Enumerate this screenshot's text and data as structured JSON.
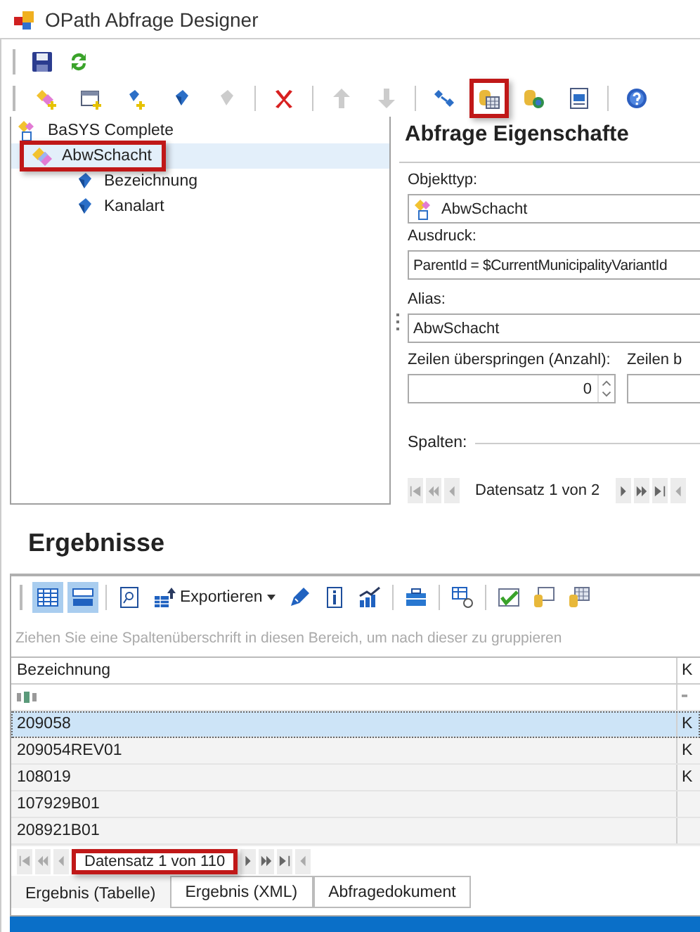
{
  "window": {
    "title": "OPath Abfrage Designer"
  },
  "toolbar_1": [
    {
      "kind": "save",
      "disabled": false
    },
    {
      "kind": "refresh",
      "disabled": false
    }
  ],
  "toolbar_2": [
    {
      "kind": "add-object",
      "disabled": false,
      "highlighted": false
    },
    {
      "kind": "add-table",
      "disabled": false,
      "highlighted": false
    },
    {
      "kind": "add-field",
      "disabled": false,
      "highlighted": false
    },
    {
      "kind": "field",
      "disabled": false,
      "highlighted": false
    },
    {
      "kind": "remove-field",
      "disabled": true,
      "highlighted": false
    },
    {
      "kind": "separator"
    },
    {
      "kind": "delete",
      "disabled": false,
      "highlighted": false
    },
    {
      "kind": "separator"
    },
    {
      "kind": "up",
      "disabled": true,
      "highlighted": false
    },
    {
      "kind": "down",
      "disabled": true,
      "highlighted": false
    },
    {
      "kind": "separator"
    },
    {
      "kind": "link",
      "disabled": false,
      "highlighted": false
    },
    {
      "kind": "db-table",
      "disabled": false,
      "highlighted": true
    },
    {
      "kind": "db-globe",
      "disabled": false,
      "highlighted": false
    },
    {
      "kind": "xml-doc",
      "disabled": false,
      "highlighted": false
    },
    {
      "kind": "separator"
    },
    {
      "kind": "help",
      "disabled": false,
      "highlighted": false
    }
  ],
  "tree": [
    {
      "kind": "root",
      "label": "BaSYS Complete",
      "selected": false,
      "highlighted": false,
      "children": [
        {
          "kind": "object",
          "label": "AbwSchacht",
          "selected": true,
          "highlighted": true,
          "children": [
            {
              "kind": "field",
              "label": "Bezeichnung",
              "selected": false,
              "highlighted": false
            },
            {
              "kind": "field",
              "label": "Kanalart",
              "selected": false,
              "highlighted": false
            }
          ]
        }
      ]
    }
  ],
  "properties": {
    "title": "Abfrage Eigenschafte",
    "objekttyp": {
      "label": "Objekttyp:",
      "value": "AbwSchacht"
    },
    "ausdruck": {
      "label": "Ausdruck:",
      "value": "ParentId = $CurrentMunicipalityVariantId"
    },
    "alias": {
      "label": "Alias:",
      "value": "AbwSchacht"
    },
    "skip_rows": {
      "label": "Zeilen überspringen (Anzahl):",
      "value": "0"
    },
    "field_2": {
      "label": "Zeilen b"
    },
    "spalten": {
      "label": "Spalten:"
    },
    "navigator": {
      "record": "Datensatz 1 von 2",
      "highlighted": false
    }
  },
  "results": {
    "title": "Ergebnisse",
    "toolbar": [
      {
        "kind": "grid-view",
        "selected": true
      },
      {
        "kind": "card-view",
        "selected": true
      },
      {
        "kind": "separator"
      },
      {
        "kind": "find",
        "selected": false
      },
      {
        "kind": "export",
        "label": "Exportieren",
        "selected": false
      },
      {
        "kind": "pen",
        "selected": false
      },
      {
        "kind": "info",
        "selected": false
      },
      {
        "kind": "chart",
        "selected": false
      },
      {
        "kind": "separator"
      },
      {
        "kind": "toolbox",
        "selected": false
      },
      {
        "kind": "separator"
      },
      {
        "kind": "column-refresh",
        "selected": false
      },
      {
        "kind": "separator"
      },
      {
        "kind": "checked-box",
        "selected": false
      },
      {
        "kind": "db-window",
        "selected": false
      },
      {
        "kind": "db-grid",
        "selected": false
      }
    ],
    "group_hint": "Ziehen Sie eine Spaltenüberschrift in diesen Bereich, um nach dieser zu gruppieren",
    "table": {
      "columns": [
        "Bezeichnung",
        "K"
      ],
      "rows": [
        {
          "cells": [
            "209058",
            "K"
          ],
          "selected": true
        },
        {
          "cells": [
            "209054REV01",
            "K"
          ],
          "selected": false
        },
        {
          "cells": [
            "108019",
            "K"
          ],
          "selected": false
        },
        {
          "cells": [
            "107929B01",
            ""
          ],
          "selected": false
        },
        {
          "cells": [
            "208921B01",
            ""
          ],
          "selected": false
        }
      ]
    },
    "navigator": {
      "record": "Datensatz 1 von 110",
      "highlighted": true
    },
    "tabs": [
      {
        "label": "Ergebnis (Tabelle)",
        "selected": true
      },
      {
        "label": "Ergebnis (XML)",
        "selected": false
      },
      {
        "label": "Abfragedokument",
        "selected": false
      }
    ]
  }
}
